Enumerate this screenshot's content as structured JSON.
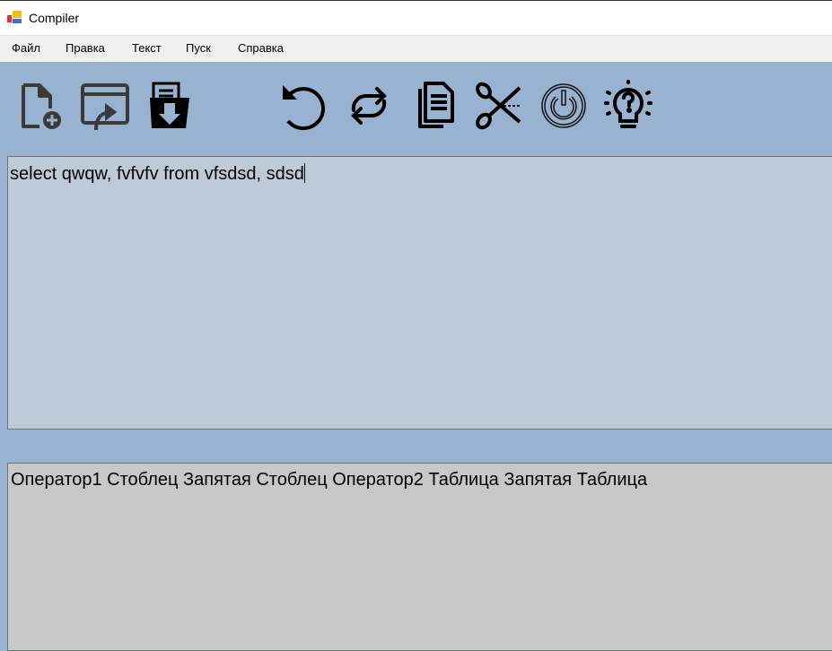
{
  "window": {
    "title": "Compiler"
  },
  "menu": [
    "Файл",
    "Правка",
    "Текст",
    "Пуск",
    "Справка"
  ],
  "toolbar": [
    {
      "icon": "new-file-icon"
    },
    {
      "icon": "open-file-icon"
    },
    {
      "icon": "save-file-icon"
    },
    {
      "icon": "undo-icon"
    },
    {
      "icon": "redo-icon"
    },
    {
      "icon": "copy-icon"
    },
    {
      "icon": "cut-icon"
    },
    {
      "icon": "run-icon"
    },
    {
      "icon": "help-icon"
    }
  ],
  "editor": {
    "value": "select qwqw, fvfvfv from vfsdsd, sdsd"
  },
  "output": {
    "value": "Оператор1 Стоблец Запятая Стоблец Оператор2 Таблица Запятая Таблица"
  },
  "colors": {
    "background": "#98b2cf",
    "editor": "#bdcbd9",
    "output": "#c8c8c8"
  }
}
